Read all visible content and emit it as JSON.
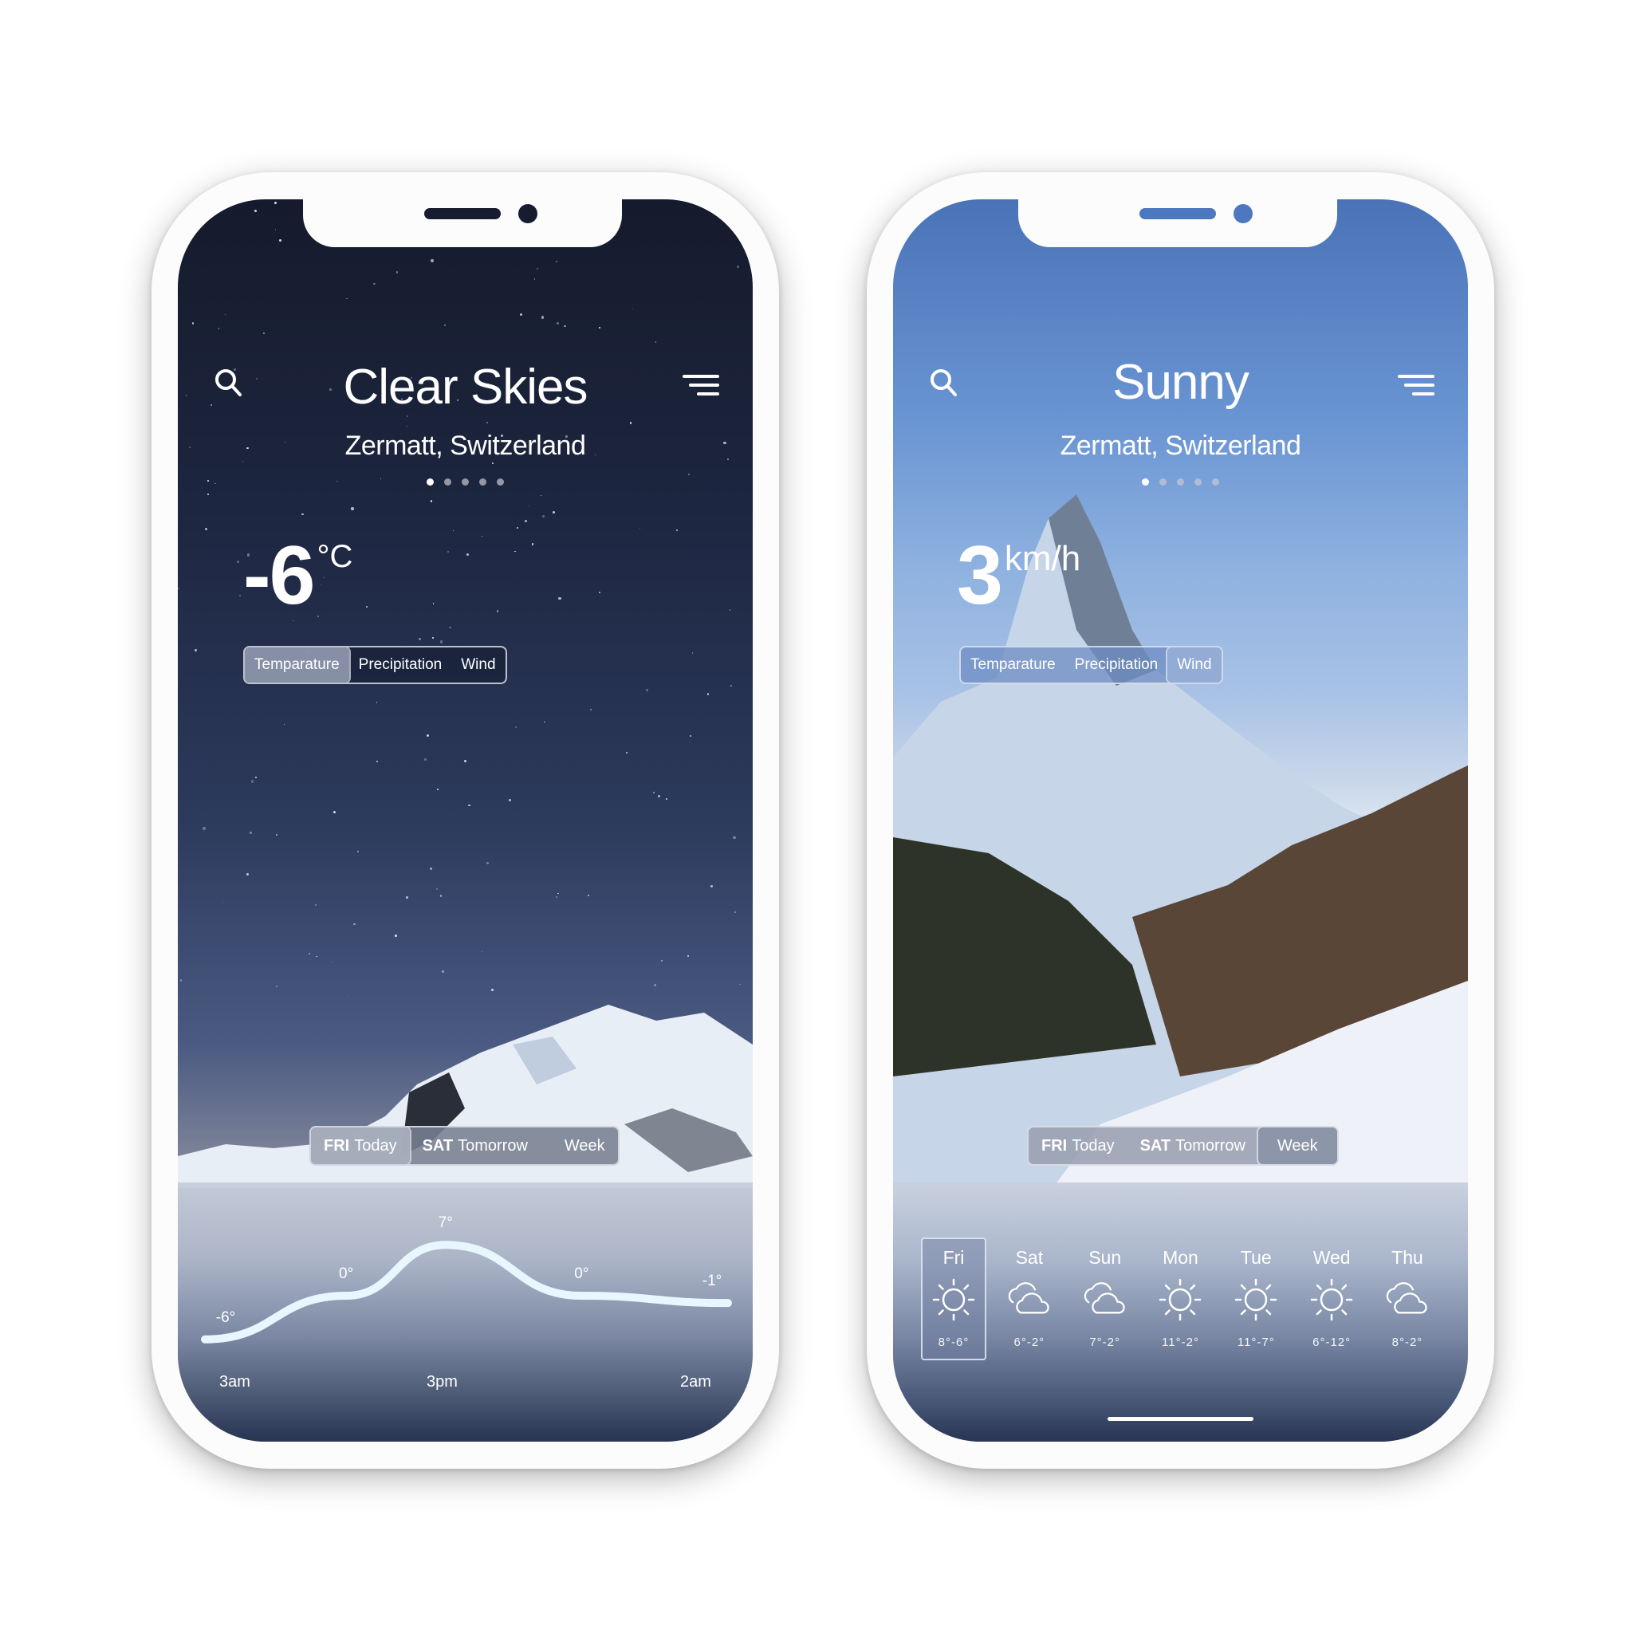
{
  "colors": {
    "night_sky": "#171d2e",
    "day_sky": "#4d78c0",
    "text": "#ffffff",
    "chart_line": "#e8f6ff"
  },
  "phone_left": {
    "condition": "Clear Skies",
    "location": "Zermatt, Switzerland",
    "page_dots": {
      "count": 5,
      "active_index": 0
    },
    "big_value": {
      "number": "-6",
      "unit": "°C"
    },
    "metric_tabs": [
      {
        "label": "Temparature",
        "active": true
      },
      {
        "label": "Precipitation",
        "active": false
      },
      {
        "label": "Wind",
        "active": false
      }
    ],
    "day_tabs": [
      {
        "day": "FRI",
        "label": "Today",
        "active": true
      },
      {
        "day": "SAT",
        "label": "Tomorrow",
        "active": false
      },
      {
        "day": "",
        "label": "Week",
        "active": false
      }
    ],
    "icons": {
      "search": "search-icon",
      "menu": "menu-icon"
    }
  },
  "phone_right": {
    "condition": "Sunny",
    "location": "Zermatt, Switzerland",
    "page_dots": {
      "count": 5,
      "active_index": 0
    },
    "big_value": {
      "number": "3",
      "unit": "km/h"
    },
    "metric_tabs": [
      {
        "label": "Temparature",
        "active": false
      },
      {
        "label": "Precipitation",
        "active": false
      },
      {
        "label": "Wind",
        "active": true
      }
    ],
    "day_tabs": [
      {
        "day": "FRI",
        "label": "Today",
        "active": false
      },
      {
        "day": "SAT",
        "label": "Tomorrow",
        "active": false
      },
      {
        "day": "",
        "label": "Week",
        "active": true
      }
    ],
    "forecast": [
      {
        "day": "Fri",
        "icon": "sun",
        "high": "8°",
        "low": "-6°",
        "active": true
      },
      {
        "day": "Sat",
        "icon": "cloud",
        "high": "6°",
        "low": "-2°",
        "active": false
      },
      {
        "day": "Sun",
        "icon": "cloud",
        "high": "7°",
        "low": "-2°",
        "active": false
      },
      {
        "day": "Mon",
        "icon": "sun",
        "high": "11°",
        "low": "-2°",
        "active": false
      },
      {
        "day": "Tue",
        "icon": "sun",
        "high": "11°",
        "low": "-7°",
        "active": false
      },
      {
        "day": "Wed",
        "icon": "sun",
        "high": "6°",
        "low": "-12°",
        "active": false
      },
      {
        "day": "Thu",
        "icon": "cloud",
        "high": "8°",
        "low": "-2°",
        "active": false
      }
    ]
  },
  "chart_data": {
    "type": "line",
    "title": "",
    "series": [
      {
        "name": "Temperature",
        "points": [
          {
            "t": 0,
            "value": -6,
            "label": "-6°"
          },
          {
            "t": 0.27,
            "value": 0,
            "label": "0°"
          },
          {
            "t": 0.46,
            "value": 7,
            "label": "7°"
          },
          {
            "t": 0.72,
            "value": 0,
            "label": "0°"
          },
          {
            "t": 1.0,
            "value": -1,
            "label": "-1°"
          }
        ]
      }
    ],
    "x_tick_labels": [
      {
        "t": 0.05,
        "label": "3am"
      },
      {
        "t": 0.45,
        "label": "3pm"
      },
      {
        "t": 0.95,
        "label": "2am"
      }
    ],
    "ylim": [
      -8,
      9
    ],
    "grid": false,
    "legend": "none"
  }
}
